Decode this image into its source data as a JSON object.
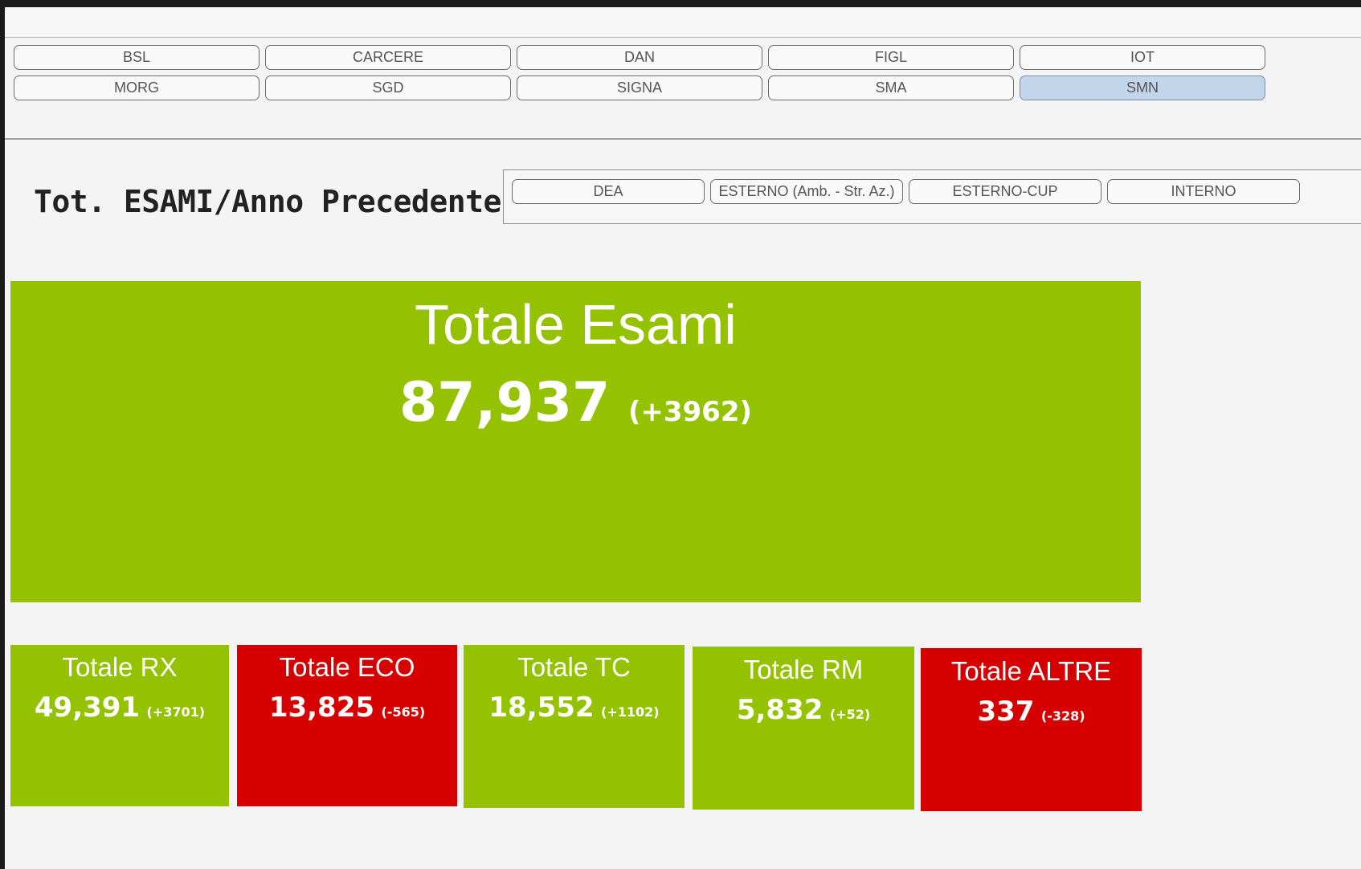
{
  "hospitals": {
    "row1": [
      "BSL",
      "CARCERE",
      "DAN",
      "FIGL",
      "IOT"
    ],
    "row2": [
      "MORG",
      "SGD",
      "SIGNA",
      "SMA",
      "SMN"
    ],
    "selected": "SMN"
  },
  "page_title": "Tot. ESAMI/Anno Precedente",
  "sources": [
    "DEA",
    "ESTERNO (Amb. - Str. Az.)",
    "ESTERNO-CUP",
    "INTERNO"
  ],
  "colors": {
    "positive": "#94c200",
    "negative": "#d60000",
    "selected_button": "#c3d5ea"
  },
  "main_kpi": {
    "title": "Totale Esami",
    "value": "87,937",
    "delta": "(+3962)",
    "status": "positive"
  },
  "kpis": [
    {
      "title": "Totale RX",
      "value": "49,391",
      "delta": "(+3701)",
      "status": "positive"
    },
    {
      "title": "Totale ECO",
      "value": "13,825",
      "delta": "(-565)",
      "status": "negative"
    },
    {
      "title": "Totale TC",
      "value": "18,552",
      "delta": "(+1102)",
      "status": "positive"
    },
    {
      "title": "Totale RM",
      "value": "5,832",
      "delta": "(+52)",
      "status": "positive"
    },
    {
      "title": "Totale ALTRE",
      "value": "337",
      "delta": "(-328)",
      "status": "negative"
    }
  ]
}
